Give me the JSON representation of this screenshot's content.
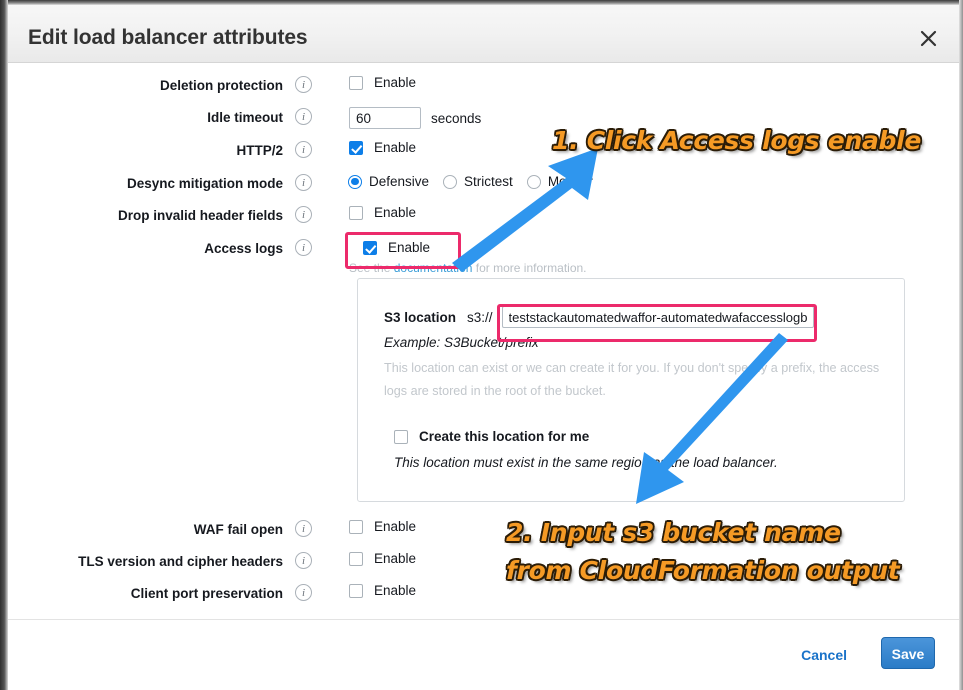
{
  "window": {
    "title": "Edit load balancer attributes",
    "close_icon": "close-icon"
  },
  "form": {
    "rows": [
      {
        "label": "Deletion protection",
        "type": "checkbox",
        "checked": false,
        "control_label": "Enable",
        "info_icon": "info-icon"
      },
      {
        "label": "Idle timeout",
        "type": "text",
        "value": "60",
        "unit": "seconds",
        "info_icon": "info-icon"
      },
      {
        "label": "HTTP/2",
        "type": "checkbox",
        "checked": true,
        "control_label": "Enable",
        "info_icon": "info-icon"
      },
      {
        "label": "Desync mitigation mode",
        "type": "radio",
        "options": [
          "Defensive",
          "Strictest",
          "Monitor"
        ],
        "selected": "Defensive",
        "info_icon": "info-icon"
      },
      {
        "label": "Drop invalid header fields",
        "type": "checkbox",
        "checked": false,
        "control_label": "Enable",
        "info_icon": "info-icon"
      },
      {
        "label": "Access logs",
        "type": "checkbox",
        "checked": true,
        "control_label": "Enable",
        "info_icon": "info-icon",
        "highlighted": true
      }
    ],
    "doc_note": {
      "prefix": "See the",
      "link": "documentation",
      "suffix": "for more information."
    },
    "s3_panel": {
      "label": "S3 location",
      "protocol": "s3://",
      "value": "teststackautomatedwaffor-automatedwafaccesslogbu",
      "placeholder": "",
      "example": "Example: S3Bucket/prefix",
      "help": "This location can exist or we can create it for you. If you don't specify a prefix, the access logs are stored in the root of the bucket.",
      "create_label": "Create this location for me",
      "create_checked": false,
      "create_note": "This location must exist in the same region as the load balancer."
    },
    "bottom_rows": [
      {
        "label": "WAF fail open",
        "type": "checkbox",
        "checked": false,
        "control_label": "Enable",
        "info_icon": "info-icon"
      },
      {
        "label": "TLS version and cipher headers",
        "type": "checkbox",
        "checked": false,
        "control_label": "Enable",
        "info_icon": "info-icon"
      },
      {
        "label": "Client port preservation",
        "type": "checkbox",
        "checked": false,
        "control_label": "Enable",
        "info_icon": "info-icon"
      }
    ]
  },
  "footer": {
    "cancel_label": "Cancel",
    "save_label": "Save"
  },
  "annotations": [
    {
      "text": "1. Click Access logs enable"
    },
    {
      "text": "2. Input s3 bucket name"
    },
    {
      "text": "from CloudFormation output"
    }
  ],
  "colors": {
    "accent_blue": "#0d7ee8",
    "highlight_pink": "#ec2a6b",
    "annotation_orange": "#f59a25",
    "arrow_blue": "#2f96ee",
    "link_blue": "#3b9dd8",
    "save_button_blue": "#2b7cc7"
  }
}
